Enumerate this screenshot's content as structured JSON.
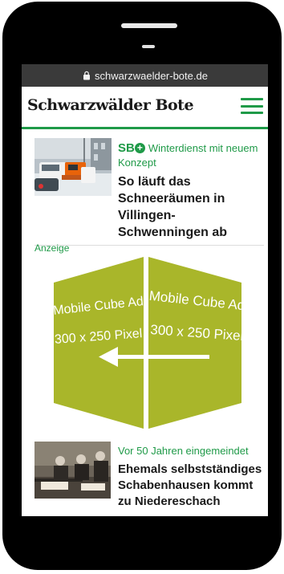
{
  "browser": {
    "url": "schwarzwaelder-bote.de"
  },
  "site": {
    "logo_text": "Schwarzwälder Bote",
    "accent_color": "#1f9a48",
    "menu_icon": "hamburger-menu-icon"
  },
  "articles": [
    {
      "badge": "SB",
      "badge_icon": "plus-icon",
      "kicker": "Winterdienst mit neuem Konzept",
      "headline": "So läuft das Schneeräumen in Villingen-Schwenningen ab"
    },
    {
      "kicker": "Vor 50 Jahren eingemeindet",
      "headline": "Ehemals selbstständiges Schabenhausen kommt zu Niedereschach"
    }
  ],
  "ad": {
    "label": "Anzeige",
    "left_line1": "Mobile Cube Ad",
    "left_line2": "300 x 250 Pixel",
    "right_line1": "Mobile Cube Ad",
    "right_line2": "300 x 250 Pixel",
    "arrow_icon": "left-arrow-icon",
    "color": "#a9b62a"
  }
}
